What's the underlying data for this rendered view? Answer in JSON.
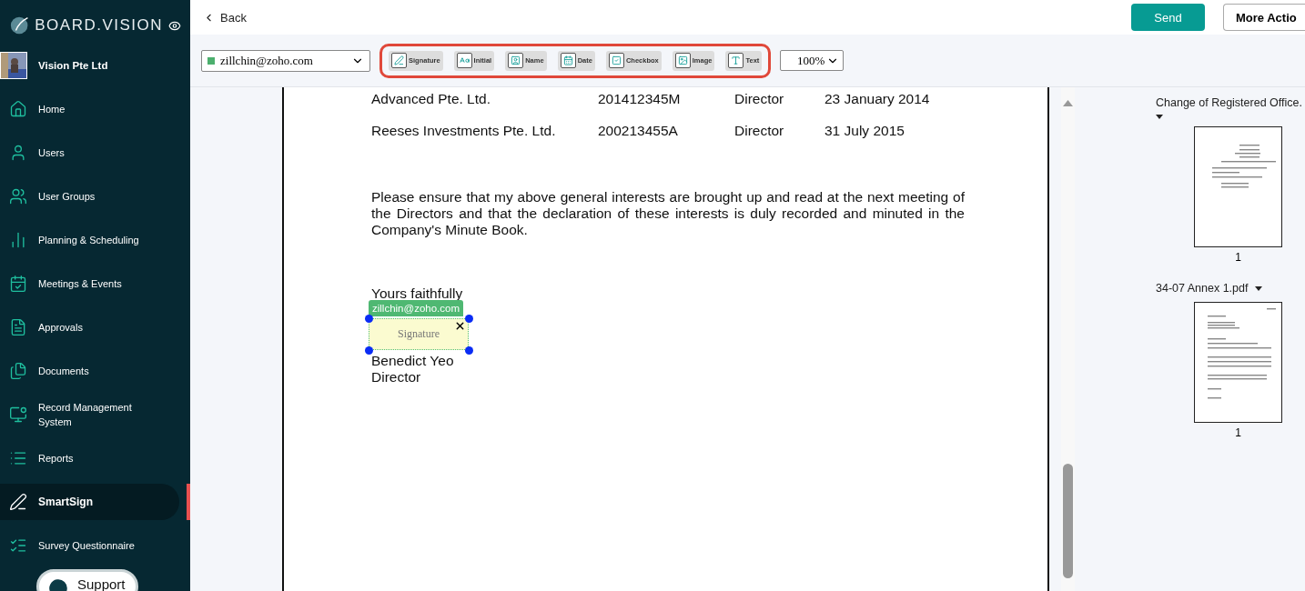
{
  "sidebar": {
    "brand": "BOARD.VISION",
    "org": "Vision Pte Ltd",
    "items": [
      {
        "label": "Home",
        "selected": false
      },
      {
        "label": "Users",
        "selected": false
      },
      {
        "label": "User Groups",
        "selected": false
      },
      {
        "label": "Planning & Scheduling",
        "selected": false
      },
      {
        "label": "Meetings & Events",
        "selected": false
      },
      {
        "label": "Approvals",
        "selected": false
      },
      {
        "label": "Documents",
        "selected": false
      },
      {
        "label": "Record Management System",
        "selected": false
      },
      {
        "label": "Reports",
        "selected": false
      },
      {
        "label": "SmartSign",
        "selected": true
      },
      {
        "label": "Survey Questionnaire",
        "selected": false
      }
    ],
    "support": "Support"
  },
  "topbar": {
    "back": "Back",
    "send": "Send",
    "more": "More Actio"
  },
  "toolbar": {
    "signer": "zillchin@zoho.com",
    "fields": [
      {
        "label": "Signature"
      },
      {
        "label": "Initial"
      },
      {
        "label": "Name"
      },
      {
        "label": "Date"
      },
      {
        "label": "Checkbox"
      },
      {
        "label": "Image"
      },
      {
        "label": "Text"
      }
    ],
    "zoom": "100%"
  },
  "document": {
    "rows": [
      [
        "Advanced Pte. Ltd.",
        "201412345M",
        "Director",
        "23 January 2014"
      ],
      [
        "Reeses Investments Pte. Ltd.",
        "200213455A",
        "Director",
        "31 July 2015"
      ]
    ],
    "paragraph": "Please ensure that my above general interests are brought up and read at the next meeting of the Directors and that the declaration of these interests is duly recorded and minuted in the Company's Minute Book.",
    "closing": "Yours faithfully",
    "signature_field": {
      "signer": "zillchin@zoho.com",
      "label": "Signature"
    },
    "signatory": "Benedict Yeo",
    "title": "Director"
  },
  "thumbnails": [
    {
      "name": "Change of Registered Office.",
      "page": "1",
      "kind": "notice"
    },
    {
      "name": "34-07 Annex 1.pdf",
      "page": "1",
      "kind": "letter"
    }
  ]
}
